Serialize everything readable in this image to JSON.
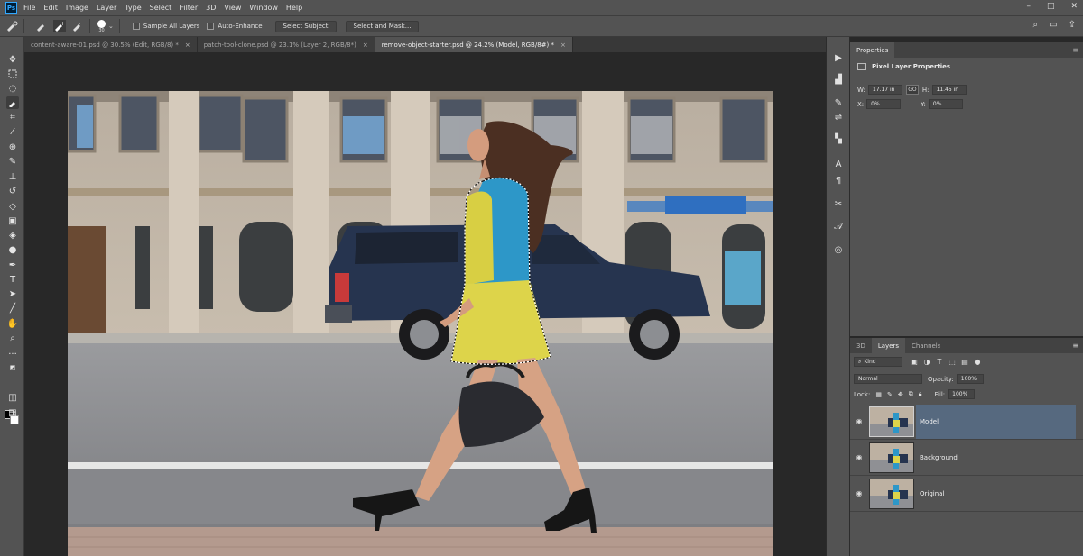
{
  "menubar": {
    "logo": "Ps",
    "items": [
      "File",
      "Edit",
      "Image",
      "Layer",
      "Type",
      "Select",
      "Filter",
      "3D",
      "View",
      "Window",
      "Help"
    ],
    "window_controls": [
      "–",
      "□",
      "✕"
    ]
  },
  "options": {
    "brush_size": "30",
    "sample_all_layers": "Sample All Layers",
    "auto_enhance": "Auto-Enhance",
    "select_subject": "Select Subject",
    "select_and_mask": "Select and Mask..."
  },
  "tabs": [
    {
      "label": "content-aware-01.psd @ 30.5% (Edit, RGB/8) *",
      "close": "×"
    },
    {
      "label": "patch-tool-clone.psd @ 23.1% (Layer 2, RGB/8*)",
      "close": "×"
    },
    {
      "label": "remove-object-starter.psd @ 24.2% (Model, RGB/8#) *",
      "close": "×"
    }
  ],
  "properties": {
    "tab": "Properties",
    "title": "Pixel Layer Properties",
    "w_label": "W:",
    "w_value": "17.17 in",
    "h_label": "H:",
    "h_value": "11.45 in",
    "x_label": "X:",
    "x_value": "0%",
    "y_label": "Y:",
    "y_value": "0%",
    "link": "GO"
  },
  "layers_panel": {
    "tabs": [
      "3D",
      "Layers",
      "Channels"
    ],
    "active_tab": "Layers",
    "filter_kind": "Kind",
    "blend_mode": "Normal",
    "opacity_label": "Opacity:",
    "opacity_value": "100%",
    "lock_label": "Lock:",
    "fill_label": "Fill:",
    "fill_value": "100%",
    "layers": [
      {
        "name": "Model",
        "selected": true
      },
      {
        "name": "Background",
        "selected": false
      },
      {
        "name": "Original",
        "selected": false
      }
    ]
  },
  "colors": {
    "accent": "#31a8ff",
    "selected_layer": "#56697f",
    "panel": "#535353"
  }
}
